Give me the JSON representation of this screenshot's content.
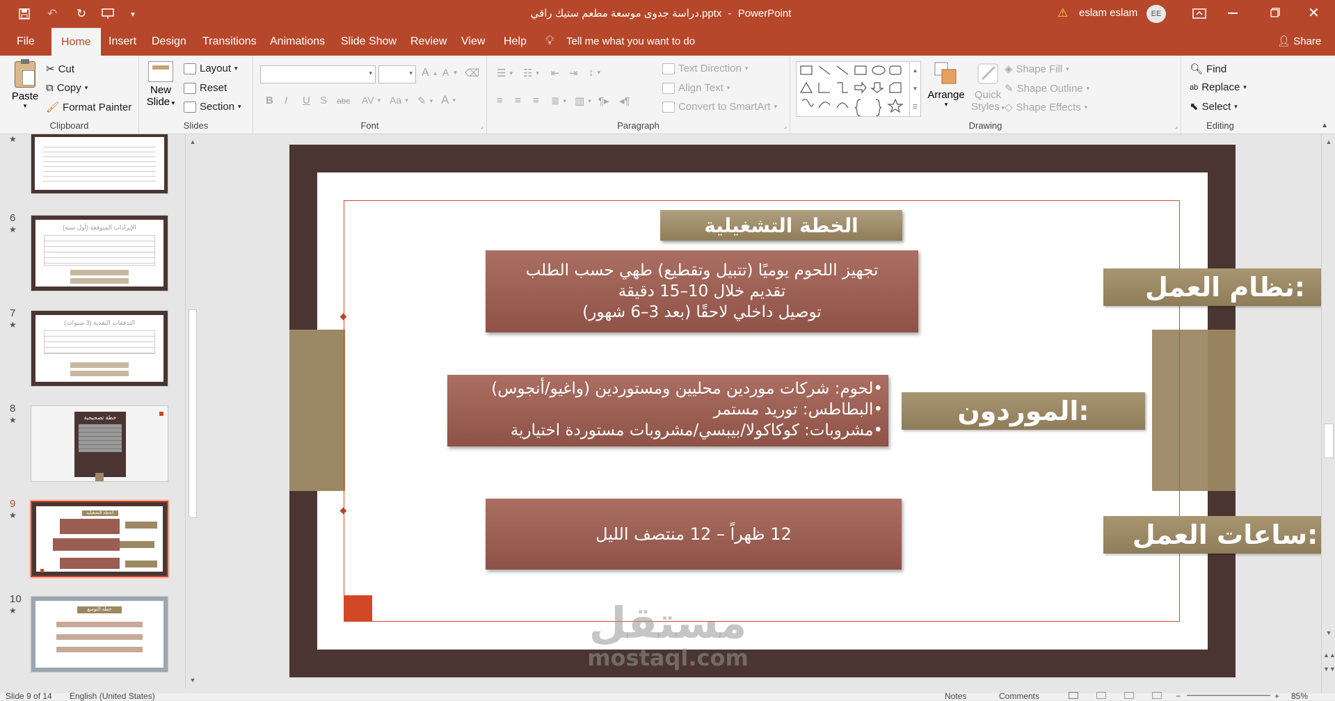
{
  "titlebar": {
    "doc_title": "دراسة جدوى موسعة مطعم ستيك راقي.pptx",
    "separator": "-",
    "app_name": "PowerPoint",
    "user_name": "eslam eslam",
    "user_initials": "EE"
  },
  "tabs": {
    "file": "File",
    "home": "Home",
    "insert": "Insert",
    "design": "Design",
    "transitions": "Transitions",
    "animations": "Animations",
    "slide_show": "Slide Show",
    "review": "Review",
    "view": "View",
    "help": "Help",
    "tell_me": "Tell me what you want to do",
    "share": "Share"
  },
  "ribbon": {
    "clipboard": {
      "paste": "Paste",
      "cut": "Cut",
      "copy": "Copy",
      "format_painter": "Format Painter",
      "label": "Clipboard"
    },
    "slides": {
      "new_slide_1": "New",
      "new_slide_2": "Slide",
      "layout": "Layout",
      "reset": "Reset",
      "section": "Section",
      "label": "Slides"
    },
    "font": {
      "bold": "B",
      "italic": "I",
      "underline": "U",
      "shadow": "S",
      "strike": "abc",
      "spacing": "AV",
      "case": "Aa",
      "color": "A",
      "label": "Font"
    },
    "paragraph": {
      "text_direction": "Text Direction",
      "align_text": "Align Text",
      "smartart": "Convert to SmartArt",
      "label": "Paragraph"
    },
    "drawing": {
      "arrange": "Arrange",
      "quick_styles_1": "Quick",
      "quick_styles_2": "Styles",
      "shape_fill": "Shape Fill",
      "shape_outline": "Shape Outline",
      "shape_effects": "Shape Effects",
      "label": "Drawing"
    },
    "editing": {
      "find": "Find",
      "replace": "Replace",
      "select": "Select",
      "label": "Editing"
    }
  },
  "thumbnails": [
    {
      "num": "",
      "title": "",
      "active": false
    },
    {
      "num": "6",
      "title": "الإيرادات المتوقعة (أول سنة)",
      "active": false
    },
    {
      "num": "7",
      "title": "التدفقات النقدية (3 سنوات)",
      "active": false
    },
    {
      "num": "8",
      "title": "خطة تصحيحية",
      "active": false
    },
    {
      "num": "9",
      "title": "الخطة التشغيلية",
      "active": true
    },
    {
      "num": "10",
      "title": "خطة التوسع",
      "active": false
    }
  ],
  "slide": {
    "title": "الخطة التشغيلية",
    "label_work_system": "نظام العمل:",
    "work_system_lines": [
      "تجهيز اللحوم يوميًا (تتبيل وتقطيع) طهي حسب الطلب",
      "تقديم خلال 10–15 دقيقة",
      "توصيل داخلي لاحقًا  (بعد 3–6 شهور)"
    ],
    "label_suppliers": "الموردون:",
    "suppliers_lines": [
      "•لحوم: شركات موردين محليين ومستوردين (واغيو/أنجوس)",
      "•البطاطس: توريد مستمر",
      "•مشروبات: كوكاكولا/بيبسي/مشروبات مستوردة اختيارية"
    ],
    "label_hours": "ساعات العمل:",
    "hours_text": "12 ظهراً – 12 منتصف الليل"
  },
  "watermark": {
    "arabic": "مستقل",
    "latin": "mostaql.com"
  },
  "status": {
    "slide_info": "Slide 9 of 14",
    "language": "English (United States)",
    "notes": "Notes",
    "comments": "Comments",
    "zoom": "85%"
  },
  "colors": {
    "accent": "#b7472a",
    "frame": "#4a3532",
    "tan": "#9c8864",
    "box": "#9b5d52",
    "orange": "#d24726"
  }
}
